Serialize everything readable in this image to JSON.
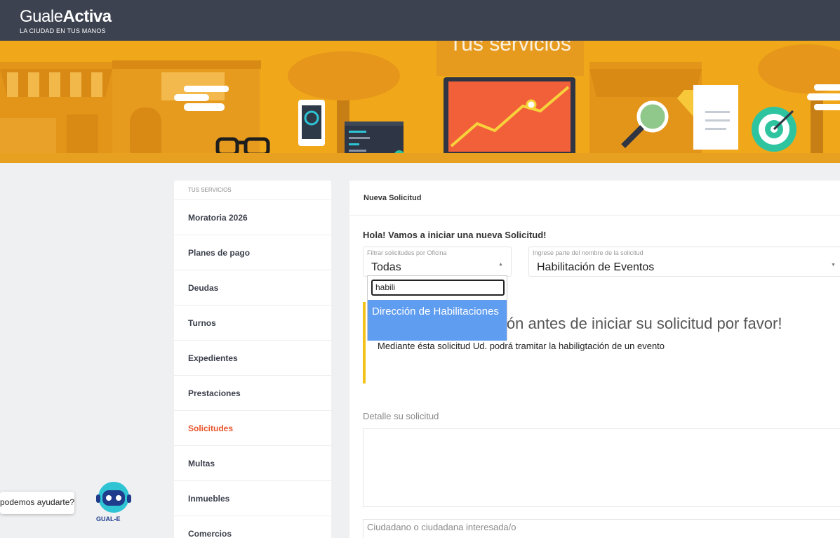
{
  "brand": {
    "name_light": "Guale",
    "name_bold": "Activa",
    "tagline": "LA CIUDAD EN TUS MANOS"
  },
  "hero": {
    "title": "Tus servicios"
  },
  "sidebar": {
    "header": "TUS SERVICIOS",
    "items": [
      {
        "label": "Moratoria 2026",
        "active": false
      },
      {
        "label": "Planes de pago",
        "active": false
      },
      {
        "label": "Deudas",
        "active": false
      },
      {
        "label": "Turnos",
        "active": false
      },
      {
        "label": "Expedientes",
        "active": false
      },
      {
        "label": "Prestaciones",
        "active": false
      },
      {
        "label": "Solicitudes",
        "active": true
      },
      {
        "label": "Multas",
        "active": false
      },
      {
        "label": "Inmuebles",
        "active": false
      },
      {
        "label": "Comercios",
        "active": false
      }
    ]
  },
  "main": {
    "header": "Nueva Solicitud",
    "greeting": "Hola! Vamos a iniciar una nueva Solicitud!",
    "office_filter": {
      "label": "Filtrar solicitudes por Oficina",
      "value": "Todas"
    },
    "request_search": {
      "label": "Ingrese parte del nombre de la solicitud",
      "value": "Habilitación de Eventos"
    },
    "dropdown": {
      "search_value": "habili",
      "option": "Dirección de Habilitaciones"
    },
    "notice": {
      "heading": "Lea esta información antes de iniciar su solicitud por favor!",
      "heading_visible": "ión antes de iniciar su solicitud por favor!",
      "body": "Mediante ésta solicitud Ud. podrá tramitar la habiligtación de un evento"
    },
    "detail_label": "Detalle su solicitud",
    "citizen_placeholder": "Ciudadano o ciudadana interesada/o"
  },
  "chat": {
    "bubble": "¿En qué podemos ayudarte?",
    "bubble_visible": "podemos ayudarte?",
    "bot_name": "GUAL-E"
  },
  "colors": {
    "topbar": "#3d4250",
    "hero": "#f0a81a",
    "accent": "#e8542a",
    "highlight": "#5f9df0",
    "notice_border": "#f2c21a"
  }
}
